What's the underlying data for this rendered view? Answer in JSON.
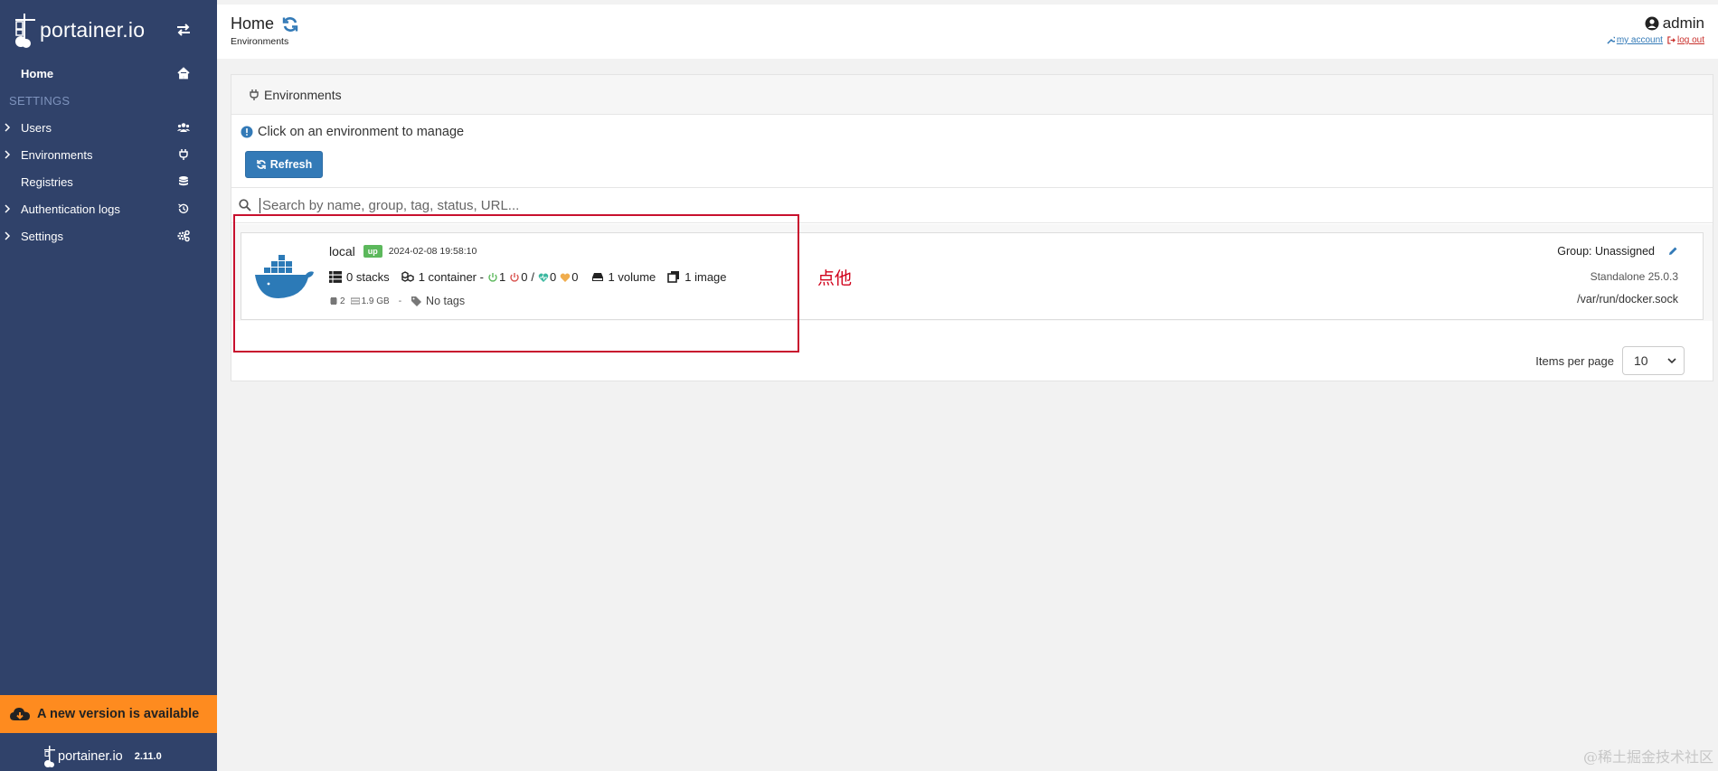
{
  "sidebar": {
    "brand": "portainer.io",
    "home_label": "Home",
    "section_title": "SETTINGS",
    "items": [
      {
        "label": "Users",
        "icon": "users-icon"
      },
      {
        "label": "Environments",
        "icon": "plug-icon"
      },
      {
        "label": "Registries",
        "icon": "database-icon"
      },
      {
        "label": "Authentication logs",
        "icon": "history-icon"
      },
      {
        "label": "Settings",
        "icon": "gears-icon"
      }
    ],
    "update_banner": "A new version is available",
    "footer_brand": "portainer.io",
    "version": "2.11.0"
  },
  "header": {
    "title": "Home",
    "breadcrumb": "Environments",
    "user": "admin",
    "my_account": "my account",
    "log_out": "log out"
  },
  "panel": {
    "title": "Environments",
    "info": "Click on an environment to manage",
    "refresh_label": "Refresh",
    "search_placeholder": "Search by name, group, tag, status, URL..."
  },
  "environment": {
    "name": "local",
    "status": "up",
    "timestamp": "2024-02-08 19:58:10",
    "stacks": "0 stacks",
    "containers": "1 container -",
    "running": "1",
    "stopped": "0",
    "slash": "/",
    "healthy": "0",
    "unhealthy": "0",
    "volumes": "1 volume",
    "images": "1 image",
    "cpu": "2",
    "memory": "1.9 GB",
    "separator": "-",
    "tags": "No tags",
    "group": "Group: Unassigned",
    "engine": "Standalone 25.0.3",
    "socket": "/var/run/docker.sock"
  },
  "pagination": {
    "label": "Items per page",
    "value": "10"
  },
  "annotation": {
    "text": "点他"
  },
  "watermark": "@稀土掘金技术社区",
  "colors": {
    "sidebar": "#30426a",
    "accent": "#337ab7",
    "banner": "#fe8b1f",
    "badge_up": "#5cb85c",
    "annotation": "#c8102e"
  }
}
